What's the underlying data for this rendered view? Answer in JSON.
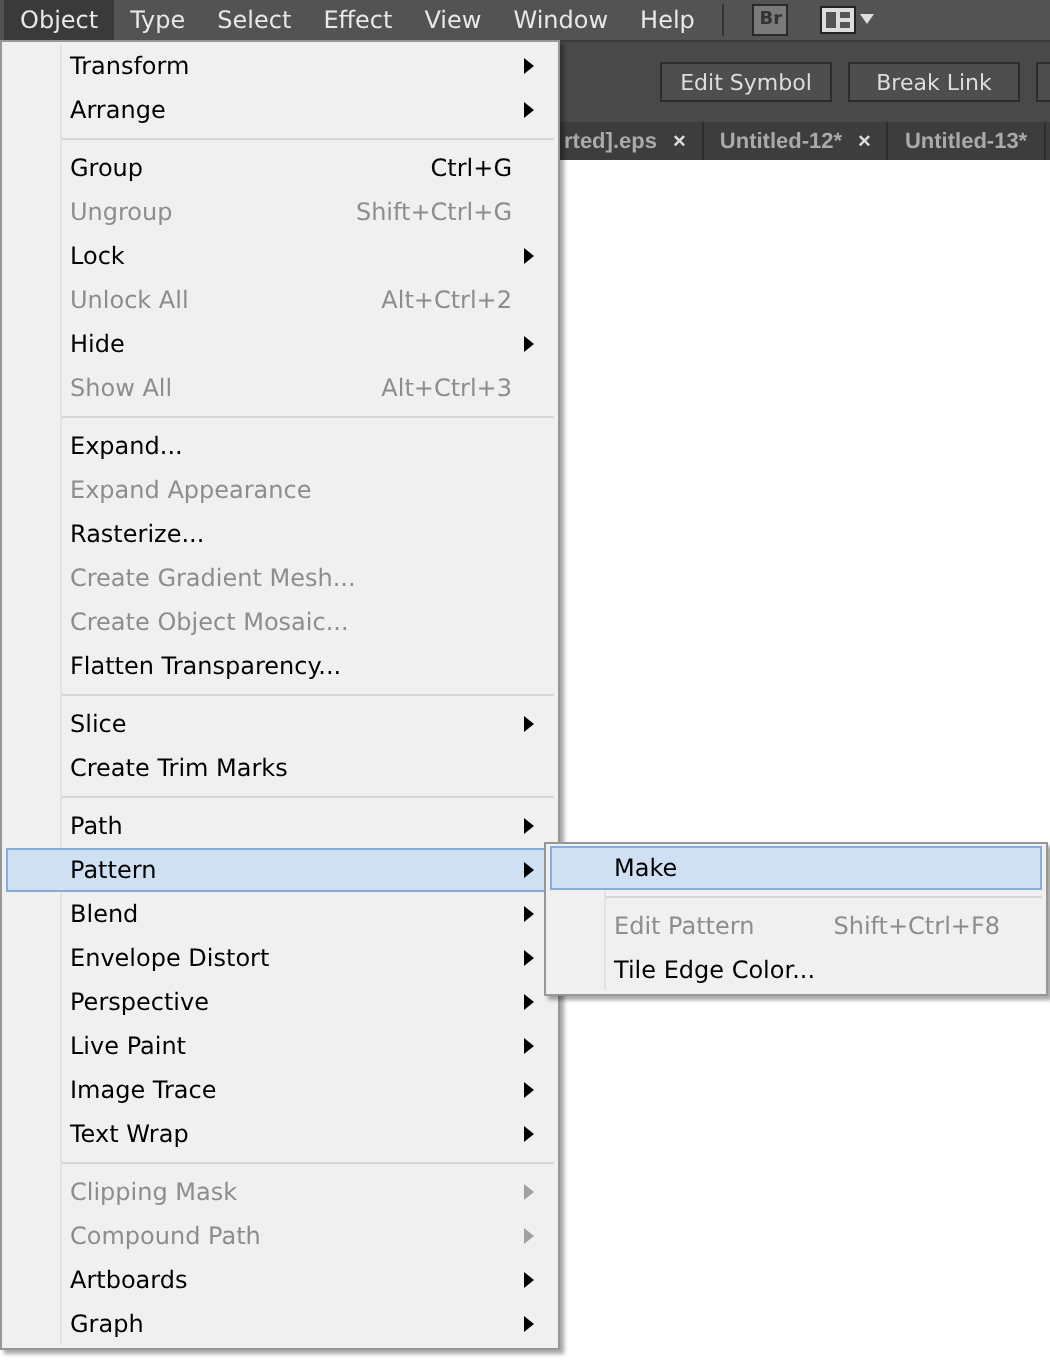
{
  "menubar": [
    {
      "label": "Object",
      "selected": true
    },
    {
      "label": "Type",
      "selected": false
    },
    {
      "label": "Select",
      "selected": false
    },
    {
      "label": "Effect",
      "selected": false
    },
    {
      "label": "View",
      "selected": false
    },
    {
      "label": "Window",
      "selected": false
    },
    {
      "label": "Help",
      "selected": false
    }
  ],
  "bridge_button": {
    "label": "Br"
  },
  "control_bar": {
    "buttons": [
      "Edit Symbol",
      "Break Link"
    ]
  },
  "document_tabs": [
    {
      "label": "rted].eps",
      "close": "×"
    },
    {
      "label": "Untitled-12*",
      "close": "×"
    },
    {
      "label": "Untitled-13*"
    }
  ],
  "menu": {
    "sections": [
      [
        {
          "label": "Transform",
          "submenu": true,
          "disabled": false,
          "selected": false
        },
        {
          "label": "Arrange",
          "submenu": true,
          "disabled": false,
          "selected": false
        }
      ],
      [
        {
          "label": "Group",
          "shortcut": "Ctrl+G",
          "submenu": false,
          "disabled": false,
          "selected": false
        },
        {
          "label": "Ungroup",
          "shortcut": "Shift+Ctrl+G",
          "submenu": false,
          "disabled": true,
          "selected": false
        },
        {
          "label": "Lock",
          "submenu": true,
          "disabled": false,
          "selected": false
        },
        {
          "label": "Unlock All",
          "shortcut": "Alt+Ctrl+2",
          "submenu": false,
          "disabled": true,
          "selected": false
        },
        {
          "label": "Hide",
          "submenu": true,
          "disabled": false,
          "selected": false
        },
        {
          "label": "Show All",
          "shortcut": "Alt+Ctrl+3",
          "submenu": false,
          "disabled": true,
          "selected": false
        }
      ],
      [
        {
          "label": "Expand...",
          "submenu": false,
          "disabled": false,
          "selected": false
        },
        {
          "label": "Expand Appearance",
          "submenu": false,
          "disabled": true,
          "selected": false
        },
        {
          "label": "Rasterize...",
          "submenu": false,
          "disabled": false,
          "selected": false
        },
        {
          "label": "Create Gradient Mesh...",
          "submenu": false,
          "disabled": true,
          "selected": false
        },
        {
          "label": "Create Object Mosaic...",
          "submenu": false,
          "disabled": true,
          "selected": false
        },
        {
          "label": "Flatten Transparency...",
          "submenu": false,
          "disabled": false,
          "selected": false
        }
      ],
      [
        {
          "label": "Slice",
          "submenu": true,
          "disabled": false,
          "selected": false
        },
        {
          "label": "Create Trim Marks",
          "submenu": false,
          "disabled": false,
          "selected": false
        }
      ],
      [
        {
          "label": "Path",
          "submenu": true,
          "disabled": false,
          "selected": false
        },
        {
          "label": "Pattern",
          "submenu": true,
          "disabled": false,
          "selected": true
        },
        {
          "label": "Blend",
          "submenu": true,
          "disabled": false,
          "selected": false
        },
        {
          "label": "Envelope Distort",
          "submenu": true,
          "disabled": false,
          "selected": false
        },
        {
          "label": "Perspective",
          "submenu": true,
          "disabled": false,
          "selected": false
        },
        {
          "label": "Live Paint",
          "submenu": true,
          "disabled": false,
          "selected": false
        },
        {
          "label": "Image Trace",
          "submenu": true,
          "disabled": false,
          "selected": false
        },
        {
          "label": "Text Wrap",
          "submenu": true,
          "disabled": false,
          "selected": false
        }
      ],
      [
        {
          "label": "Clipping Mask",
          "submenu": true,
          "disabled": true,
          "selected": false
        },
        {
          "label": "Compound Path",
          "submenu": true,
          "disabled": true,
          "selected": false
        },
        {
          "label": "Artboards",
          "submenu": true,
          "disabled": false,
          "selected": false
        },
        {
          "label": "Graph",
          "submenu": true,
          "disabled": false,
          "selected": false
        }
      ]
    ]
  },
  "submenu": {
    "sections": [
      [
        {
          "label": "Make",
          "submenu": false,
          "disabled": false,
          "selected": true
        }
      ],
      [
        {
          "label": "Edit Pattern",
          "shortcut": "Shift+Ctrl+F8",
          "submenu": false,
          "disabled": true,
          "selected": false
        },
        {
          "label": "Tile Edge Color...",
          "submenu": false,
          "disabled": false,
          "selected": false
        }
      ]
    ]
  }
}
